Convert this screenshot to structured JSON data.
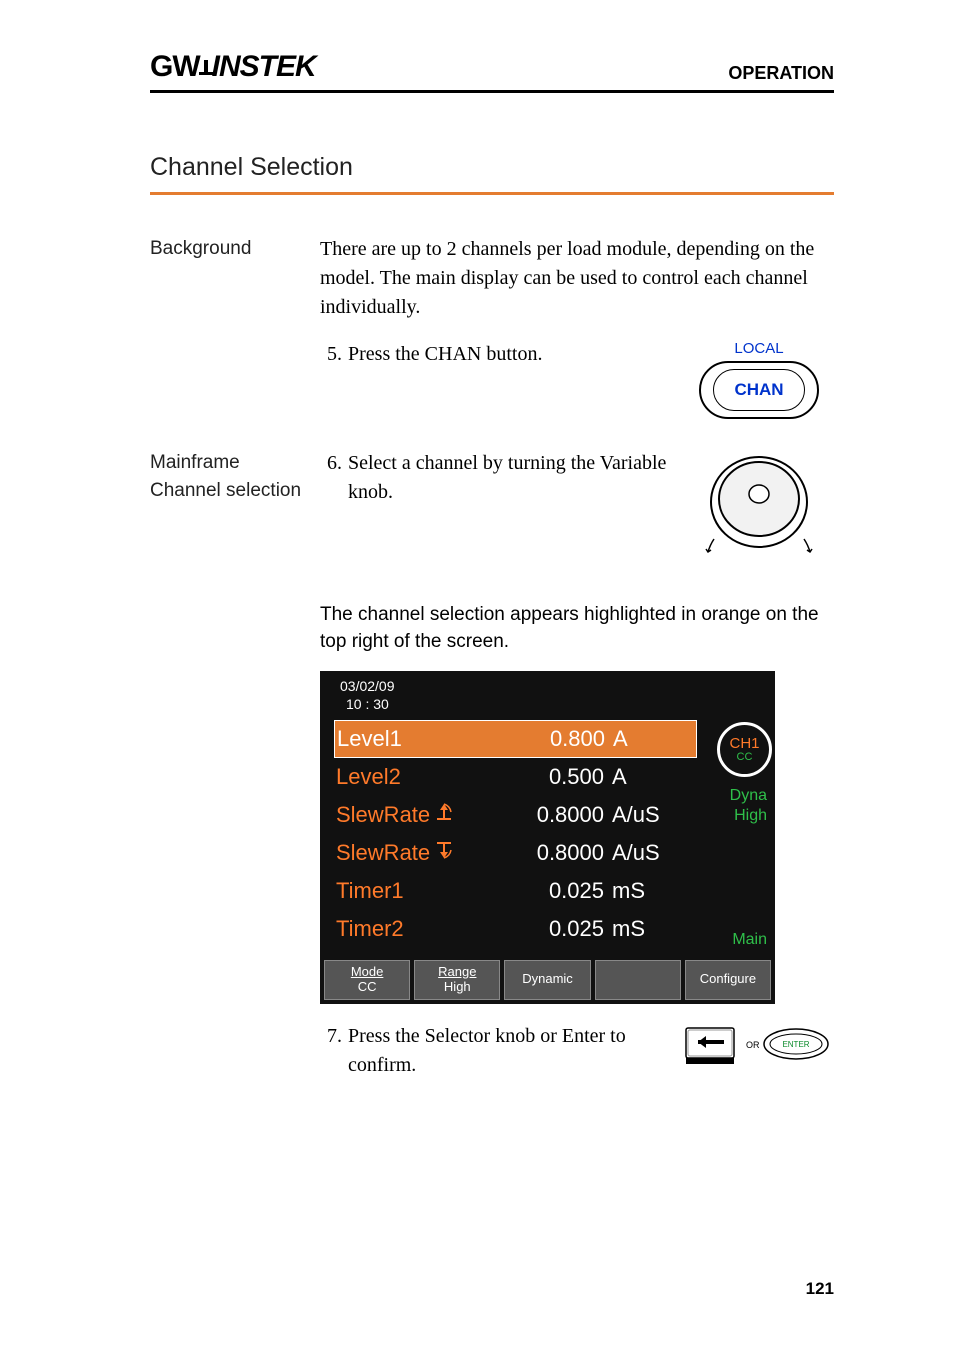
{
  "header": {
    "logo_prefix": "GW",
    "logo_suffix": "INSTEK",
    "right": "OPERATION"
  },
  "section_title": "Channel Selection",
  "background": {
    "label": "Background",
    "text": "There are up to 2 channels per load module, depending on the model.  The main display can be used to control each channel individually."
  },
  "step5": {
    "num": "5.",
    "text": "Press the CHAN button.",
    "local": "LOCAL",
    "chan": "CHAN"
  },
  "mainframe": {
    "label_line1": "Mainframe",
    "label_line2": "Channel selection",
    "num": "6.",
    "text": "Select a channel by turning the Variable knob.",
    "note": "The channel selection appears highlighted in orange on the top right of the screen."
  },
  "display": {
    "date": "03/02/09",
    "time": "10 : 30",
    "rows": [
      {
        "label": "Level1",
        "value": "0.800",
        "unit": "A",
        "sel": true,
        "arrow": ""
      },
      {
        "label": "Level2",
        "value": "0.500",
        "unit": "A",
        "sel": false,
        "arrow": ""
      },
      {
        "label": "SlewRate",
        "value": "0.8000",
        "unit": "A/uS",
        "sel": false,
        "arrow": "up"
      },
      {
        "label": "SlewRate",
        "value": "0.8000",
        "unit": "A/uS",
        "sel": false,
        "arrow": "down"
      },
      {
        "label": "Timer1",
        "value": "0.025",
        "unit": "mS",
        "sel": false,
        "arrow": ""
      },
      {
        "label": "Timer2",
        "value": "0.025",
        "unit": "mS",
        "sel": false,
        "arrow": ""
      }
    ],
    "side": {
      "ch": "CH1",
      "cc": "CC",
      "dyna": "Dyna",
      "high": "High",
      "main": "Main"
    },
    "softkeys": [
      {
        "top": "Mode",
        "bot": "CC",
        "under": true
      },
      {
        "top": "Range",
        "bot": "High",
        "under": true
      },
      {
        "top": "Dynamic",
        "bot": "",
        "under": false
      },
      {
        "top": "",
        "bot": "",
        "under": false
      },
      {
        "top": "Configure",
        "bot": "",
        "under": false
      }
    ]
  },
  "step7": {
    "num": "7.",
    "text": "Press the Selector knob or Enter to confirm.",
    "or": "OR",
    "enter": "ENTER"
  },
  "page_number": "121"
}
